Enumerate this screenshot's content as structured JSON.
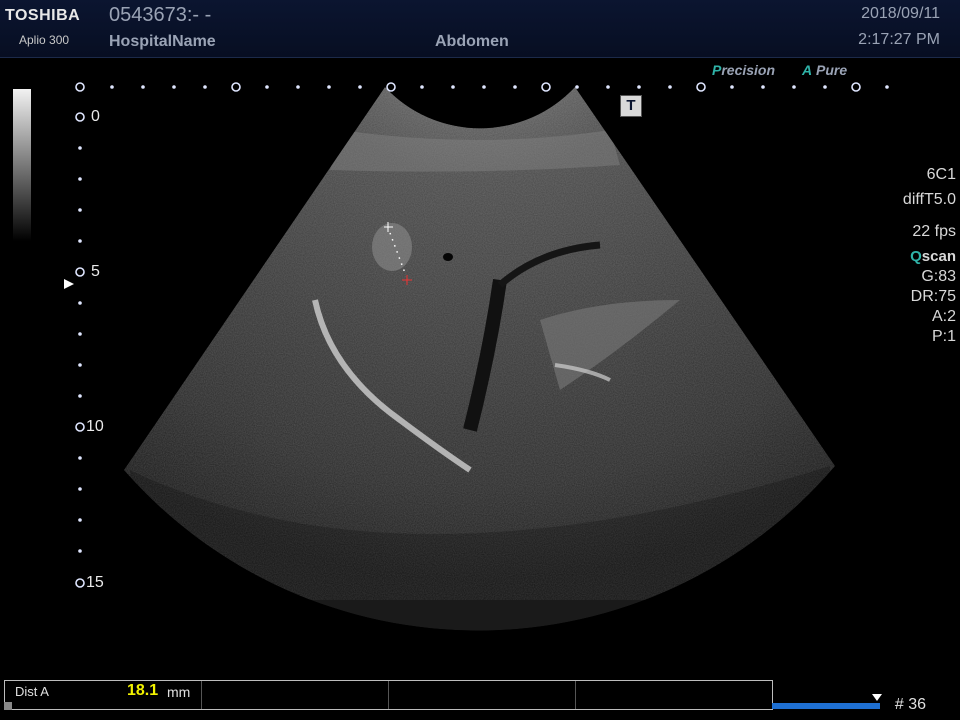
{
  "header": {
    "brand": "TOSHIBA",
    "model": "Aplio 300",
    "patient_id": "0543673:- -",
    "hospital": "HospitalName",
    "exam": "Abdomen",
    "date": "2018/09/11",
    "time": "2:17:27 PM"
  },
  "modes": {
    "precision_initial": "P",
    "precision_rest": "recision",
    "pure_initial": "A",
    "pure_rest": "Pure",
    "t_label": "T"
  },
  "depth_scale": {
    "labels": [
      "0",
      "5",
      "10",
      "15"
    ]
  },
  "params": {
    "probe": "6C1",
    "mode": "diffT5.0",
    "fps": "22 fps",
    "qscan_initial": "Q",
    "qscan_rest": "scan",
    "gain": "G:83",
    "dr": "DR:75",
    "a": "A:2",
    "p": "P:1"
  },
  "measurement": {
    "label": "Dist A",
    "value": "18.1",
    "unit": "mm"
  },
  "cine": {
    "frame": "# 36",
    "progress": 1.0
  },
  "colors": {
    "header_bg": "#0b1530",
    "accent": "#2fb3a8",
    "value": "#f2f200",
    "cine": "#1e6fd1"
  },
  "icons": [
    "focus-marker-icon",
    "t-mode-icon",
    "caliper-plus-icon"
  ]
}
